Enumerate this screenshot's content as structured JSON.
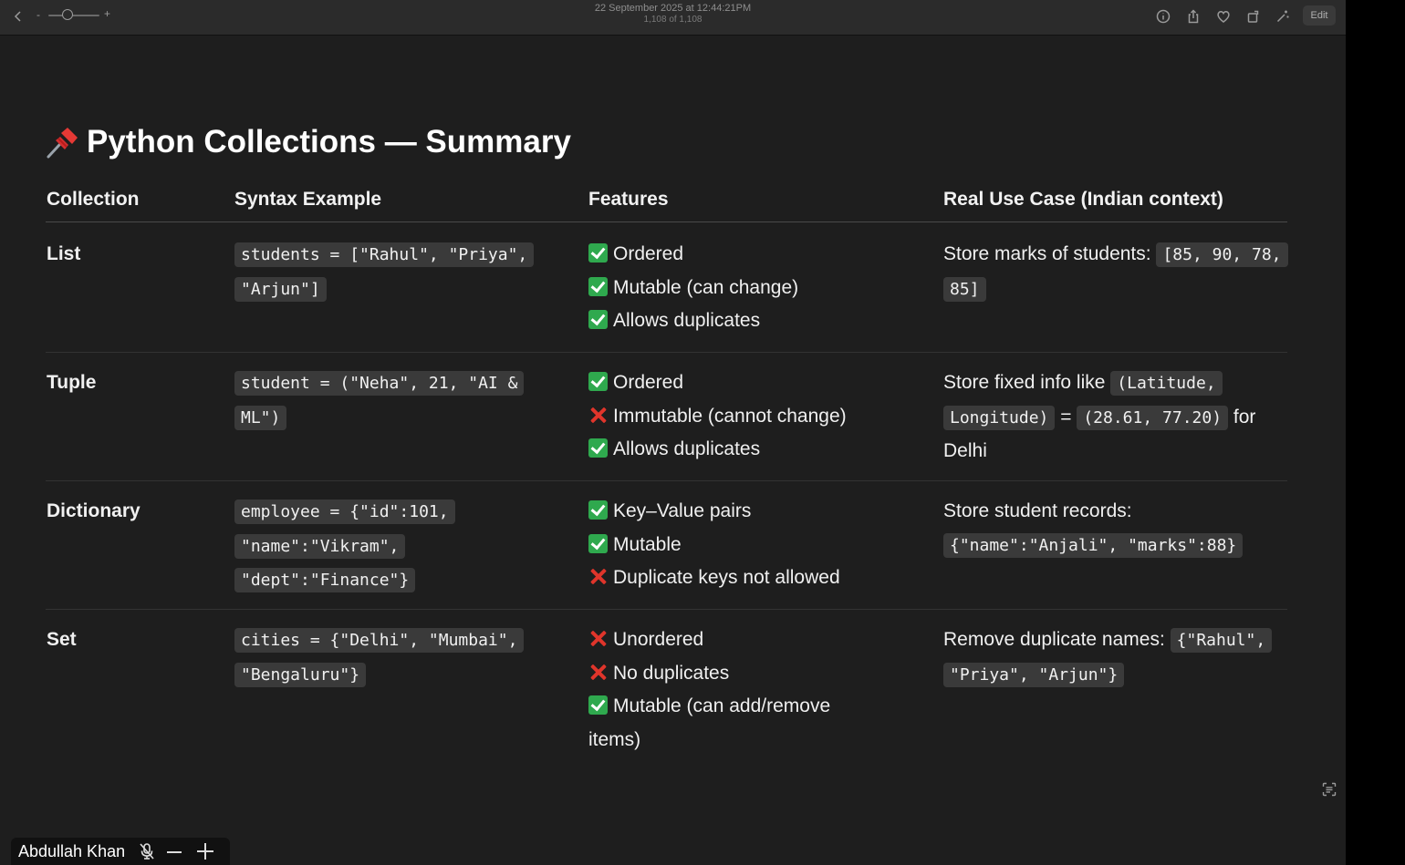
{
  "toolbar": {
    "zoom_minus": "-",
    "zoom_plus": "+",
    "date": "22 September 2025 at 12:44:21PM",
    "count": "1,108 of 1,108",
    "edit_label": "Edit",
    "icons": [
      "back-chevron-icon",
      "info-icon",
      "share-icon",
      "heart-icon",
      "rotate-icon",
      "magic-wand-icon"
    ]
  },
  "slide": {
    "title": "Python Collections — Summary",
    "title_icon": "pushpin-icon",
    "headers": [
      "Collection",
      "Syntax Example",
      "Features",
      "Real Use Case (Indian context)"
    ],
    "rows": [
      {
        "name": "List",
        "syntax": "students = [\"Rahul\", \"Priya\", \"Arjun\"]",
        "features": [
          {
            "mark": "check",
            "text": "Ordered"
          },
          {
            "mark": "check",
            "text": "Mutable (can change)"
          },
          {
            "mark": "check",
            "text": "Allows duplicates"
          }
        ],
        "use_text": "Store marks of students:",
        "use_code": "[85, 90, 78, 85]"
      },
      {
        "name": "Tuple",
        "syntax": "student = (\"Neha\", 21, \"AI & ML\")",
        "features": [
          {
            "mark": "check",
            "text": "Ordered"
          },
          {
            "mark": "cross",
            "text": "Immutable (cannot change)"
          },
          {
            "mark": "check",
            "text": "Allows duplicates"
          }
        ],
        "use_text": "Store fixed info like",
        "use_code": "(Latitude, Longitude)",
        "use_mid": "=",
        "use_code2": "(28.61, 77.20)",
        "use_tail": "for Delhi"
      },
      {
        "name": "Dictionary",
        "syntax": "employee = {\"id\":101, \"name\":\"Vikram\", \"dept\":\"Finance\"}",
        "features": [
          {
            "mark": "check",
            "text": "Key–Value pairs"
          },
          {
            "mark": "check",
            "text": "Mutable"
          },
          {
            "mark": "cross",
            "text": "Duplicate keys not allowed"
          }
        ],
        "use_text": "Store student records:",
        "use_code": "{\"name\":\"Anjali\", \"marks\":88}"
      },
      {
        "name": "Set",
        "syntax": "cities = {\"Delhi\", \"Mumbai\", \"Bengaluru\"}",
        "features": [
          {
            "mark": "cross",
            "text": "Unordered"
          },
          {
            "mark": "cross",
            "text": "No duplicates"
          },
          {
            "mark": "check",
            "text": "Mutable (can add/remove items)"
          }
        ],
        "use_text": "Remove duplicate names:",
        "use_code": "{\"Rahul\", \"Priya\", \"Arjun\"}"
      }
    ]
  },
  "participant": {
    "name": "Abdullah Khan",
    "icons": [
      "mic-muted-icon",
      "minimize-icon",
      "expand-icon"
    ]
  },
  "colors": {
    "background": "#1e1e1e",
    "toolbar": "#2b2b2b",
    "code_bg": "#3a3a3a",
    "check": "#2fa94e",
    "cross": "#e0352b"
  }
}
